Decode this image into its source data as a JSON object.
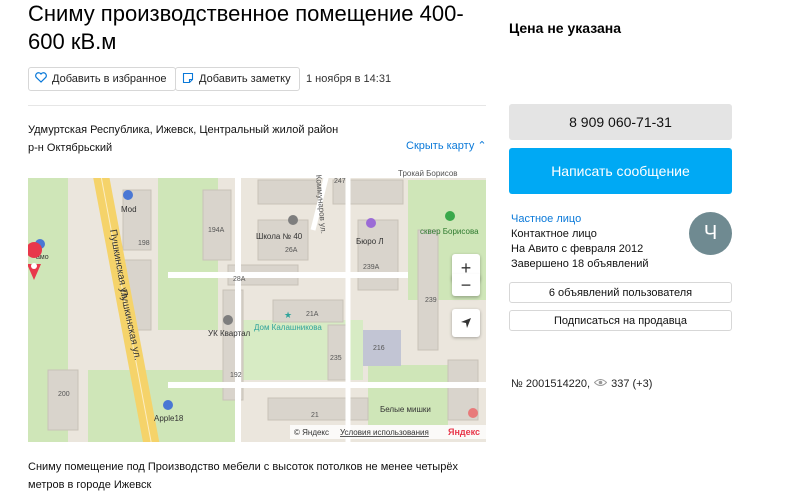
{
  "listing": {
    "title": "Сниму производственное помещение 400-600 кВ.м",
    "price": "Цена не указана",
    "add_favorite": "Добавить в избранное",
    "add_note": "Добавить заметку",
    "date": "1 ноября в 14:31",
    "address_line1": "Удмуртская Республика, Ижевск, Центральный жилой район",
    "address_line2": "р-н Октябрьский",
    "hide_map": "Скрыть карту",
    "description": "Сниму помещение под Производство мебели с высоток потолков не менее четырёх метров в городе Ижевск"
  },
  "map": {
    "street_1": "Пушкинская ул.",
    "street_2": "Пушкинская ул.",
    "street_3": "Трокай Борисов",
    "street_4": "Коммунаров ул.",
    "poi_school": "Школа № 40",
    "poi_bureau": "Бюро Л",
    "poi_square": "сквер Борисова",
    "poi_quartal": "УК Квартал",
    "poi_house": "Дом Калашникова",
    "poi_apple": "Apple18",
    "poi_mishki": "Белые мишки",
    "poi_mod": "Mod",
    "poi_amo": "амо",
    "b_194a": "194А",
    "b_198": "198",
    "b_26a": "26А",
    "b_28a": "28А",
    "b_239a": "239А",
    "b_239": "239",
    "b_21a": "21А",
    "b_235": "235",
    "b_216": "216",
    "b_192": "192",
    "b_200": "200",
    "b_21": "21",
    "b_247": "247",
    "copyright": "© Яндекс",
    "terms": "Условия использования",
    "logo": "Яндекс"
  },
  "contact": {
    "phone": "8 909 060-71-31",
    "write_message": "Написать сообщение",
    "seller_type": "Частное лицо",
    "contact_person": "Контактное лицо",
    "on_avito": "На Авито с февраля 2012",
    "completed": "Завершено 18 объявлений",
    "avatar_letter": "Ч",
    "user_ads": "6 объявлений пользователя",
    "subscribe": "Подписаться на продавца"
  },
  "meta": {
    "listing_number": "№ 2001514220,",
    "views": "337 (+3)"
  },
  "colors": {
    "accent": "#00a9f4",
    "link": "#0a79d9",
    "avatar": "#6f8a91"
  }
}
